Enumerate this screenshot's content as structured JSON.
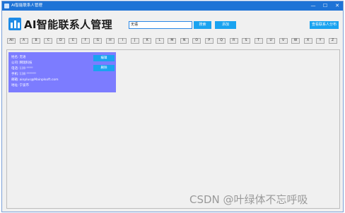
{
  "window": {
    "title": "AI智能联系人管理",
    "controls": [
      "—",
      "☐",
      "✕"
    ]
  },
  "header": {
    "brand_text": "AI智能联系人管理",
    "search_value": "无语",
    "search_button": "搜索",
    "add_button": "添加",
    "distribution_button": "查看联系人分布"
  },
  "letters": [
    "All",
    "A",
    "B",
    "C",
    "D",
    "E",
    "F",
    "G",
    "H",
    "I",
    "J",
    "K",
    "L",
    "M",
    "N",
    "O",
    "P",
    "Q",
    "R",
    "S",
    "T",
    "U",
    "V",
    "W",
    "X",
    "Y",
    "Z"
  ],
  "contact": {
    "name_label": "姓名:",
    "name": "无语",
    "company_label": "公司:",
    "company": "网瑞科技",
    "phone_label": "电话:",
    "phone": "139 ****",
    "mobile_label": "手机:",
    "mobile": "138 ******",
    "email_label": "邮箱:",
    "email": "ainplus@Mainplsoft.com",
    "address_label": "地址:",
    "address": "宁波市",
    "edit_button": "编辑",
    "delete_button": "删除"
  },
  "watermark": "CSDN @叶绿体不忘呼吸"
}
